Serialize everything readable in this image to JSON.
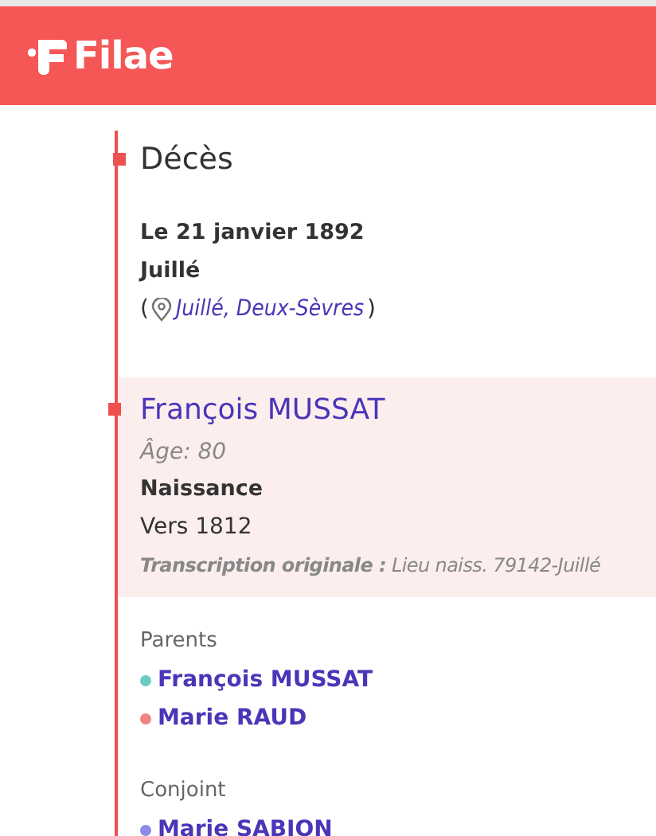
{
  "header": {
    "logo": "Filae"
  },
  "event": {
    "title": "Décès",
    "date": "Le 21 janvier 1892",
    "place": "Juillé",
    "location_open": "(",
    "location_link": "Juillé, Deux-Sèvres",
    "location_close": ")"
  },
  "person": {
    "name": "François MUSSAT",
    "age": "Âge: 80",
    "birth_label": "Naissance",
    "birth_date": "Vers 1812",
    "transcription": "**Transcription originale :** Lieu naiss. 79142-Juillé"
  },
  "relations": [
    {
      "label": "Parents",
      "people": [
        {
          "name": "François MUSSAT",
          "color": "#6ccac2"
        },
        {
          "name": "Marie RAUD",
          "color": "#f08484"
        }
      ]
    },
    {
      "label": "Conjoint",
      "people": [
        {
          "name": "Marie SABION",
          "color": "#8c8ce8"
        }
      ]
    }
  ]
}
